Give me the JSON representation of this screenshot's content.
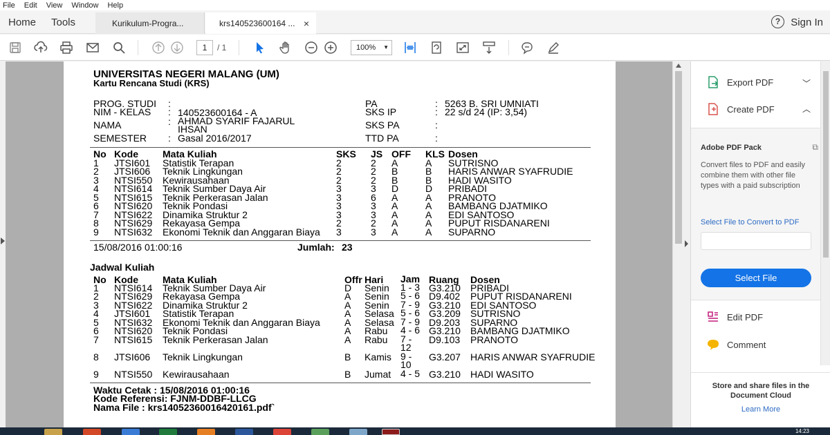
{
  "menu": [
    "File",
    "Edit",
    "View",
    "Window",
    "Help"
  ],
  "nav": {
    "home": "Home",
    "tools": "Tools"
  },
  "tabs": [
    {
      "label": "Kurikulum-Progra..."
    },
    {
      "label": "krs140523600164 ...",
      "close": "×"
    }
  ],
  "header": {
    "help": "?",
    "signin": "Sign In"
  },
  "toolbar": {
    "page_current": "1",
    "page_total": "/ 1",
    "zoom": "100%"
  },
  "doc": {
    "title": "UNIVERSITAS NEGERI MALANG (UM)",
    "subtitle": "Kartu Rencana Studi (KRS)",
    "info": {
      "prog_label": "PROG. STUDI",
      "prog_colon": ":",
      "prog_value": "",
      "nim_label": "NIM - KELAS",
      "nim_colon": ":",
      "nim_value": "140523600164 - A",
      "nama_label": "NAMA",
      "nama_colon": ":",
      "nama_value_1": "AHMAD SYARIF FAJARUL",
      "nama_value_2": "IHSAN",
      "semester_label": "SEMESTER",
      "semester_colon": ":",
      "semester_value": "Gasal 2016/2017",
      "pa_label": "PA",
      "pa_colon": ":",
      "pa_value": "5263 B. SRI UMNIATI",
      "sksip_label": "SKS IP",
      "sksip_colon": ":",
      "sksip_value": "22 s/d 24 (IP: 3,54)",
      "skspa_label": "SKS PA",
      "skspa_colon": ":",
      "ttd_label": "TTD PA",
      "ttd_colon": ":"
    },
    "krs_headers": [
      "No",
      "Kode",
      "Mata Kuliah",
      "SKS",
      "JS",
      "OFF",
      "KLS",
      "Dosen"
    ],
    "krs_rows": [
      [
        "1",
        "JTSI601",
        "Statistik Terapan",
        "2",
        "2",
        "A",
        "A",
        "SUTRISNO"
      ],
      [
        "2",
        "JTSI606",
        "Teknik Lingkungan",
        "2",
        "2",
        "B",
        "B",
        "HARIS ANWAR SYAFRUDIE"
      ],
      [
        "3",
        "NTSI550",
        "Kewirausahaan",
        "2",
        "2",
        "B",
        "B",
        "HADI WASITO"
      ],
      [
        "4",
        "NTSI614",
        "Teknik Sumber Daya Air",
        "3",
        "3",
        "D",
        "D",
        "PRIBADI"
      ],
      [
        "5",
        "NTSI615",
        "Teknik Perkerasan Jalan",
        "3",
        "6",
        "A",
        "A",
        "PRANOTO"
      ],
      [
        "6",
        "NTSI620",
        "Teknik Pondasi",
        "3",
        "3",
        "A",
        "A",
        "BAMBANG DJATMIKO"
      ],
      [
        "7",
        "NTSI622",
        "Dinamika Struktur 2",
        "3",
        "3",
        "A",
        "A",
        "EDI SANTOSO"
      ],
      [
        "8",
        "NTSI629",
        "Rekayasa Gempa",
        "2",
        "2",
        "A",
        "A",
        "PUPUT RISDANARENI"
      ],
      [
        "9",
        "NTSI632",
        "Ekonomi Teknik dan Anggaran Biaya",
        "3",
        "3",
        "A",
        "A",
        "SUPARNO"
      ]
    ],
    "timestamp": "15/08/2016 01:00:16",
    "jumlah_label": "Jumlah:",
    "jumlah_value": "23",
    "jadwal_title": "Jadwal Kuliah",
    "jadwal_headers": [
      "No",
      "Kode",
      "Mata Kuliah",
      "Offr",
      "Hari",
      "Jam",
      "Ruang",
      "Dosen"
    ],
    "jadwal_rows": [
      [
        "1",
        "NTSI614",
        "Teknik Sumber Daya Air",
        "D",
        "Senin",
        "1 - 3",
        "G3.210",
        "PRIBADI"
      ],
      [
        "2",
        "NTSI629",
        "Rekayasa Gempa",
        "A",
        "Senin",
        "5 - 6",
        "D9.402",
        "PUPUT RISDANARENI"
      ],
      [
        "3",
        "NTSI622",
        "Dinamika Struktur 2",
        "A",
        "Senin",
        "7 - 9",
        "G3.210",
        "EDI SANTOSO"
      ],
      [
        "4",
        "JTSI601",
        "Statistik Terapan",
        "A",
        "Selasa",
        "5 - 6",
        "G3.209",
        "SUTRISNO"
      ],
      [
        "5",
        "NTSI632",
        "Ekonomi Teknik dan Anggaran Biaya",
        "A",
        "Selasa",
        "7 - 9",
        "D9.203",
        "SUPARNO"
      ],
      [
        "6",
        "NTSI620",
        "Teknik Pondasi",
        "A",
        "Rabu",
        "4 - 6",
        "G3.210",
        "BAMBANG DJATMIKO"
      ],
      [
        "7",
        "NTSI615",
        "Teknik Perkerasan Jalan",
        "A",
        "Rabu",
        "7 - 12",
        "D9.103",
        "PRANOTO"
      ],
      [
        "8",
        "JTSI606",
        "Teknik Lingkungan",
        "B",
        "Kamis",
        "9 - 10",
        "G3.207",
        "HARIS ANWAR SYAFRUDIE"
      ],
      [
        "9",
        "NTSI550",
        "Kewirausahaan",
        "B",
        "Jumat",
        "4 - 5",
        "G3.210",
        "HADI WASITO"
      ]
    ],
    "footer": {
      "waktu": "Waktu Cetak : 15/08/2016 01:00:16",
      "kode": "Kode Referensi: FJNM-DDBF-LLCG",
      "nama": "Nama File : krs14052360016420161.pdf`"
    }
  },
  "rightpane": {
    "export": "Export PDF",
    "create": "Create PDF",
    "pack_title": "Adobe PDF Pack",
    "pack_desc": "Convert files to PDF and easily combine them with other file types with a paid subscription",
    "pack_link": "Select File to Convert to PDF",
    "pack_button": "Select File",
    "edit": "Edit PDF",
    "comment": "Comment",
    "store": "Store and share files in the Document Cloud",
    "learn": "Learn More"
  },
  "taskbar": {
    "clock": "14:23"
  }
}
